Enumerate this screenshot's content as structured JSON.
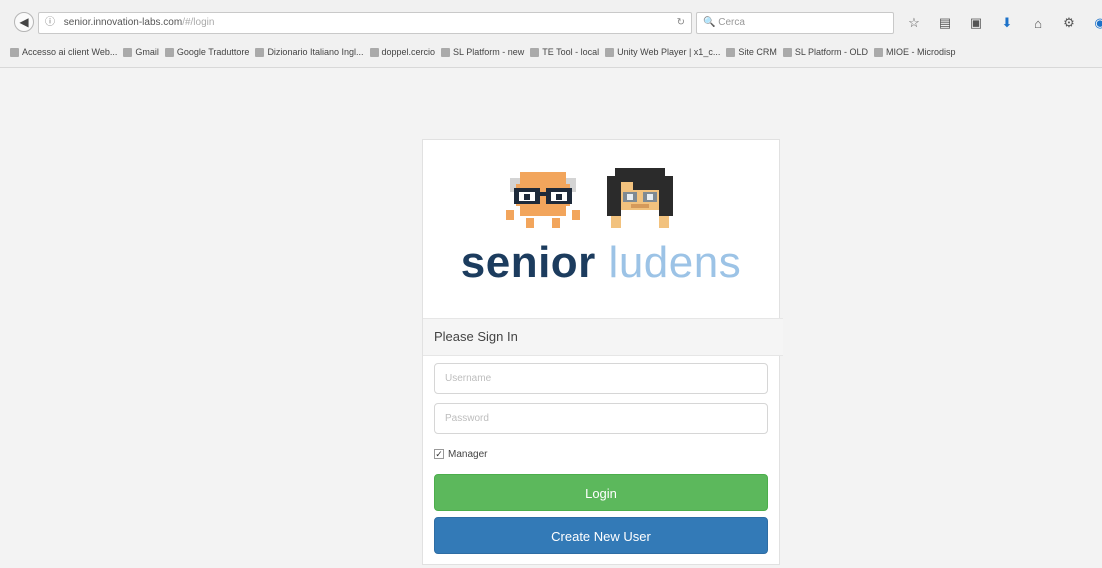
{
  "browser": {
    "url_host": "senior.innovation-labs.com",
    "url_path": "/#/login",
    "search_placeholder": "Cerca",
    "bookmarks": [
      {
        "label": "Accesso ai client Web..."
      },
      {
        "label": "Gmail"
      },
      {
        "label": "Google Traduttore"
      },
      {
        "label": "Dizionario Italiano Ingl..."
      },
      {
        "label": "doppel.cercio"
      },
      {
        "label": "SL Platform - new"
      },
      {
        "label": "TE Tool - local"
      },
      {
        "label": "Unity Web Player | x1_c..."
      },
      {
        "label": "Site CRM"
      },
      {
        "label": "SL Platform - OLD"
      },
      {
        "label": "MIOE - Microdisp"
      }
    ]
  },
  "login": {
    "brand_part1": "senior",
    "brand_part2": "ludens",
    "heading": "Please Sign In",
    "username_placeholder": "Username",
    "password_placeholder": "Password",
    "manager_label": "Manager",
    "manager_checked": true,
    "login_button": "Login",
    "create_button": "Create New User"
  },
  "colors": {
    "brand_dark": "#1c3c5e",
    "brand_light": "#9cc3e6",
    "login_green": "#5cb85c",
    "create_blue": "#337ab7"
  }
}
